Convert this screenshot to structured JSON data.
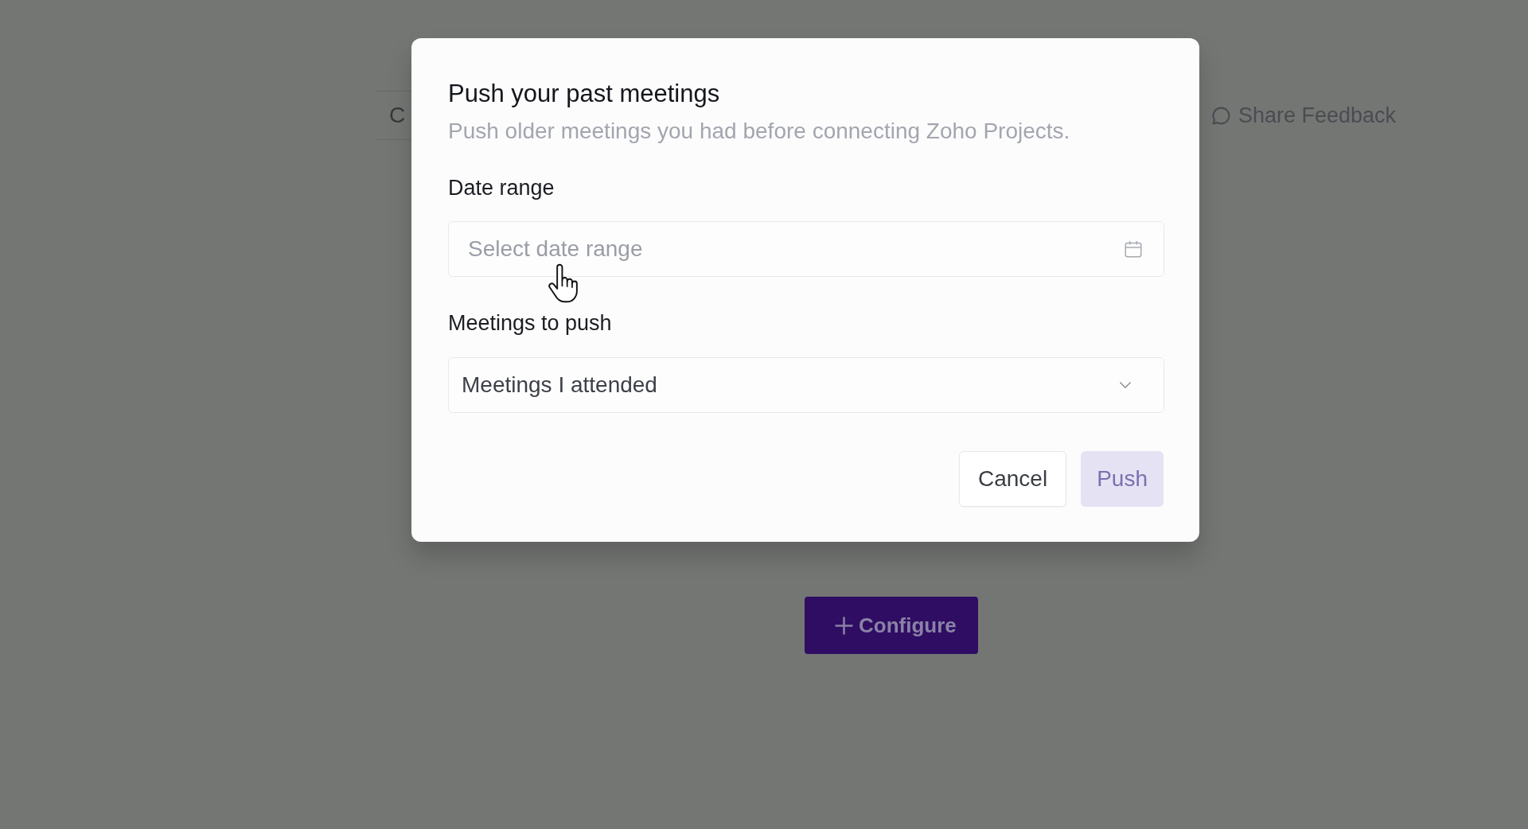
{
  "page": {
    "tab_label": "C",
    "share_feedback": "Share Feedback",
    "configure_button": "Configure"
  },
  "dialog": {
    "title": "Push your past meetings",
    "subtitle": "Push older meetings you had before connecting Zoho Projects.",
    "fields": [
      {
        "kind": "date",
        "label": "Date range",
        "placeholder": "Select date range"
      },
      {
        "kind": "select",
        "label": "Meetings to push",
        "value": "Meetings I attended"
      }
    ],
    "buttons": [
      {
        "kind": "secondary",
        "label": "Cancel",
        "disabled": false
      },
      {
        "kind": "primary",
        "label": "Push",
        "disabled": true
      }
    ]
  }
}
